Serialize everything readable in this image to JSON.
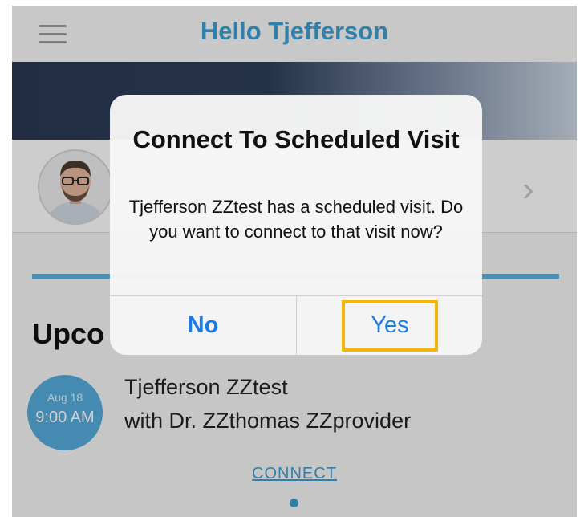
{
  "header": {
    "title": "Hello Tjefferson",
    "menu_icon": "hamburger-menu-icon"
  },
  "profile": {
    "avatar_icon": "user-photo",
    "chevron_icon": "chevron-right-icon"
  },
  "upcoming": {
    "heading_visible": "Upco"
  },
  "visit": {
    "date": "Aug 18",
    "time": "9:00 AM",
    "patient": "Tjefferson ZZtest",
    "provider": "with Dr. ZZthomas ZZprovider",
    "connect_label": "CONNECT"
  },
  "dialog": {
    "title": "Connect To Scheduled Visit",
    "message": "Tjefferson ZZtest has a scheduled visit. Do you want to connect to that visit now?",
    "no_label": "No",
    "yes_label": "Yes"
  },
  "colors": {
    "accent": "#3a9dd0",
    "ios_blue": "#1a7be8",
    "highlight": "#f2b705"
  }
}
